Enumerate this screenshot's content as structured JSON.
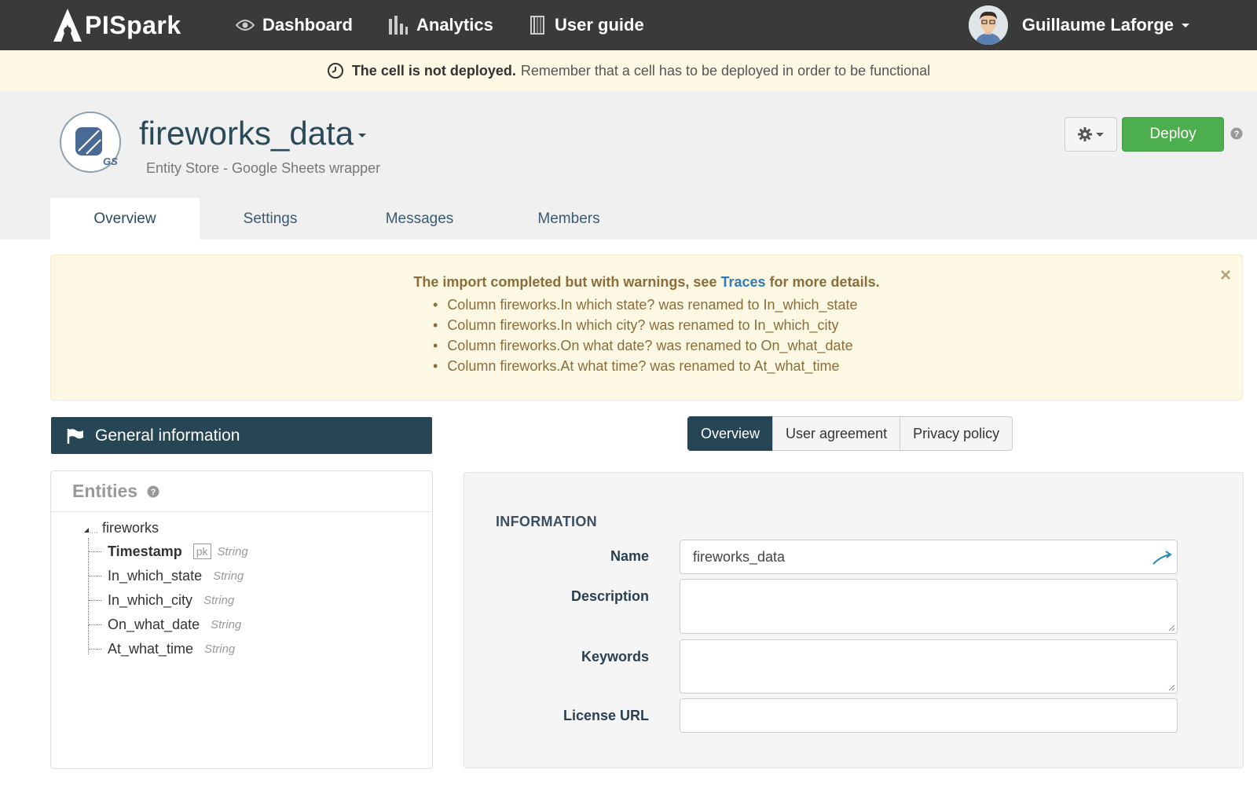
{
  "topnav": {
    "logo_text": "PISpark",
    "items": [
      {
        "label": "Dashboard",
        "icon": "eye-icon"
      },
      {
        "label": "Analytics",
        "icon": "bar-chart-icon"
      },
      {
        "label": "User guide",
        "icon": "book-icon"
      }
    ],
    "user_name": "Guillaume Laforge"
  },
  "notice": {
    "bold": "The cell is not deployed.",
    "text": "Remember that a cell has to be deployed in order to be functional"
  },
  "cell": {
    "title": "fireworks_data",
    "subtitle": "Entity Store - Google Sheets wrapper",
    "badge": "GS",
    "deploy_label": "Deploy"
  },
  "tabs": [
    "Overview",
    "Settings",
    "Messages",
    "Members"
  ],
  "warning": {
    "title_before": "The import completed but with warnings, see",
    "link": "Traces",
    "title_after": "for more details.",
    "items": [
      "Column fireworks.In which state? was renamed to In_which_state",
      "Column fireworks.In which city? was renamed to In_which_city",
      "Column fireworks.On what date? was renamed to On_what_date",
      "Column fireworks.At what time? was renamed to At_what_time"
    ],
    "close": "×"
  },
  "general_info": {
    "label": "General information"
  },
  "subtabs": [
    "Overview",
    "User agreement",
    "Privacy policy"
  ],
  "entities": {
    "title": "Entities",
    "root": "fireworks",
    "fields": [
      {
        "name": "Timestamp",
        "type": "String",
        "pk": "pk"
      },
      {
        "name": "In_which_state",
        "type": "String"
      },
      {
        "name": "In_which_city",
        "type": "String"
      },
      {
        "name": "On_what_date",
        "type": "String"
      },
      {
        "name": "At_what_time",
        "type": "String"
      }
    ]
  },
  "information": {
    "title": "INFORMATION",
    "name_label": "Name",
    "name_value": "fireworks_data",
    "description_label": "Description",
    "description_value": "",
    "keywords_label": "Keywords",
    "keywords_value": "",
    "license_label": "License URL",
    "license_value": ""
  },
  "colors": {
    "nav_bg": "#3a3a3a",
    "accent_dark": "#264655",
    "deploy_green": "#4cae4c",
    "warning_bg": "#fcf8e3",
    "link_blue": "#337ab7"
  }
}
